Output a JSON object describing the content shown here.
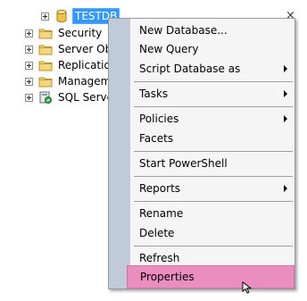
{
  "tree": {
    "database_name": "TESTDB",
    "nodes": [
      {
        "label": "Security",
        "icon": "folder-icon"
      },
      {
        "label": "Server Obj",
        "icon": "folder-icon"
      },
      {
        "label": "Replication",
        "icon": "folder-icon"
      },
      {
        "label": "Manageme",
        "icon": "folder-icon"
      },
      {
        "label": "SQL Serve",
        "icon": "sql-agent-icon"
      }
    ]
  },
  "close_glyph": "×",
  "context_menu": {
    "items": [
      {
        "label": "New Database...",
        "submenu": false
      },
      {
        "label": "New Query",
        "submenu": false
      },
      {
        "label": "Script Database as",
        "submenu": true
      },
      {
        "label": "Tasks",
        "submenu": true
      },
      {
        "label": "Policies",
        "submenu": true
      },
      {
        "label": "Facets",
        "submenu": false
      },
      {
        "label": "Start PowerShell",
        "submenu": false
      },
      {
        "label": "Reports",
        "submenu": true
      },
      {
        "label": "Rename",
        "submenu": false
      },
      {
        "label": "Delete",
        "submenu": false
      },
      {
        "label": "Refresh",
        "submenu": false
      },
      {
        "label": "Properties",
        "submenu": false,
        "highlighted": true
      }
    ]
  },
  "colors": {
    "selection": "#3399ff",
    "menu_highlight": "#ea8ec0",
    "menu_gutter": "#bfcbd8"
  }
}
